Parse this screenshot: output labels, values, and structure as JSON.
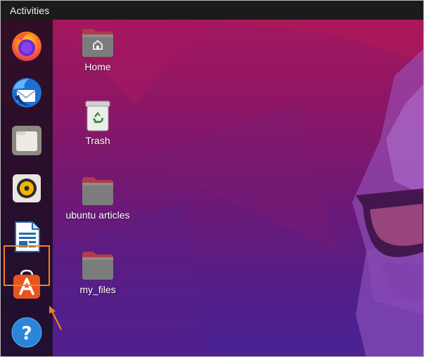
{
  "topbar": {
    "activities_label": "Activities"
  },
  "dock": {
    "apps": [
      {
        "name": "firefox",
        "icon": "firefox-icon"
      },
      {
        "name": "thunderbird",
        "icon": "thunderbird-icon"
      },
      {
        "name": "files",
        "icon": "files-icon"
      },
      {
        "name": "rhythmbox",
        "icon": "rhythmbox-icon"
      },
      {
        "name": "libreoffice-writer",
        "icon": "writer-icon"
      },
      {
        "name": "ubuntu-software",
        "icon": "software-store-icon",
        "highlighted": true
      },
      {
        "name": "help",
        "icon": "help-icon"
      }
    ]
  },
  "desktop": {
    "icons": [
      {
        "label": "Home",
        "icon": "home-folder-icon"
      },
      {
        "label": "Trash",
        "icon": "trash-icon"
      },
      {
        "label": "ubuntu articles",
        "icon": "folder-icon"
      },
      {
        "label": "my_files",
        "icon": "folder-icon"
      }
    ]
  },
  "colors": {
    "highlight": "#f0801e",
    "topbar": "#1b1b1b",
    "ubuntu_orange": "#e95420"
  }
}
